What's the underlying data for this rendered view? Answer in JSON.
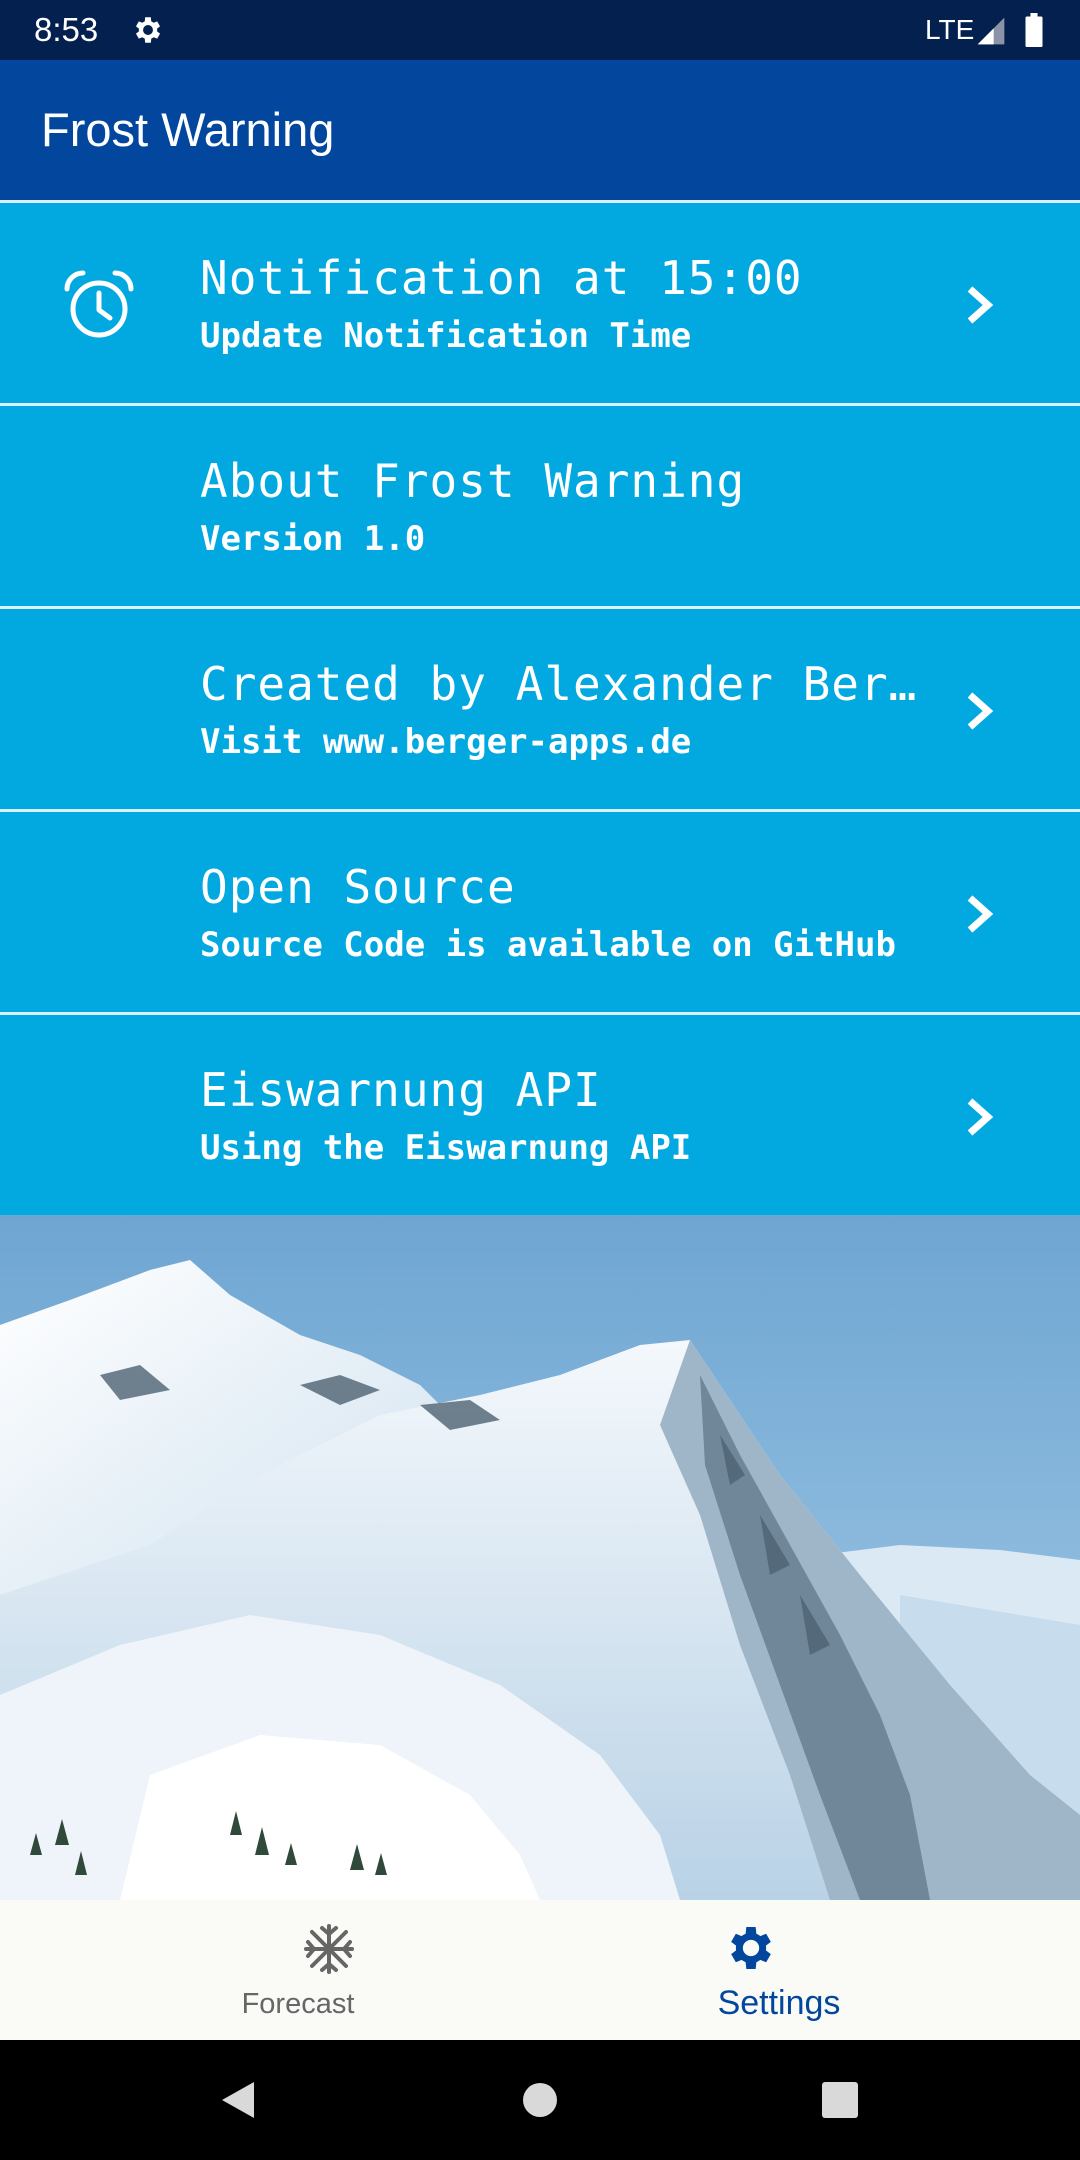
{
  "status_bar": {
    "time": "8:53",
    "network": "LTE",
    "icons": [
      "gear-icon",
      "signal-icon",
      "battery-icon"
    ]
  },
  "app_bar": {
    "title": "Frost Warning"
  },
  "settings": {
    "items": [
      {
        "title": "Notification at 15:00",
        "subtitle": "Update Notification Time",
        "icon": "alarm-clock-icon",
        "has_chevron": true
      },
      {
        "title": "About Frost Warning",
        "subtitle": "Version 1.0",
        "has_chevron": false
      },
      {
        "title": "Created by Alexander Ber…",
        "subtitle": "Visit www.berger-apps.de",
        "has_chevron": true
      },
      {
        "title": "Open Source",
        "subtitle": "Source Code is available on GitHub",
        "has_chevron": true
      },
      {
        "title": "Eiswarnung API",
        "subtitle": "Using the Eiswarnung API",
        "has_chevron": true
      }
    ]
  },
  "bottom_nav": {
    "items": [
      {
        "label": "Forecast",
        "icon": "snowflake-icon",
        "selected": false
      },
      {
        "label": "Settings",
        "icon": "gear-icon",
        "selected": true
      }
    ]
  },
  "colors": {
    "status_bar": "#04204e",
    "app_bar": "#02479d",
    "list_background": "#02a8e0",
    "divider": "#d8f1fb",
    "nav_selected": "#02479d",
    "nav_unselected": "#666666"
  },
  "system_nav": {
    "buttons": [
      "back-icon",
      "home-icon",
      "recents-icon"
    ]
  }
}
